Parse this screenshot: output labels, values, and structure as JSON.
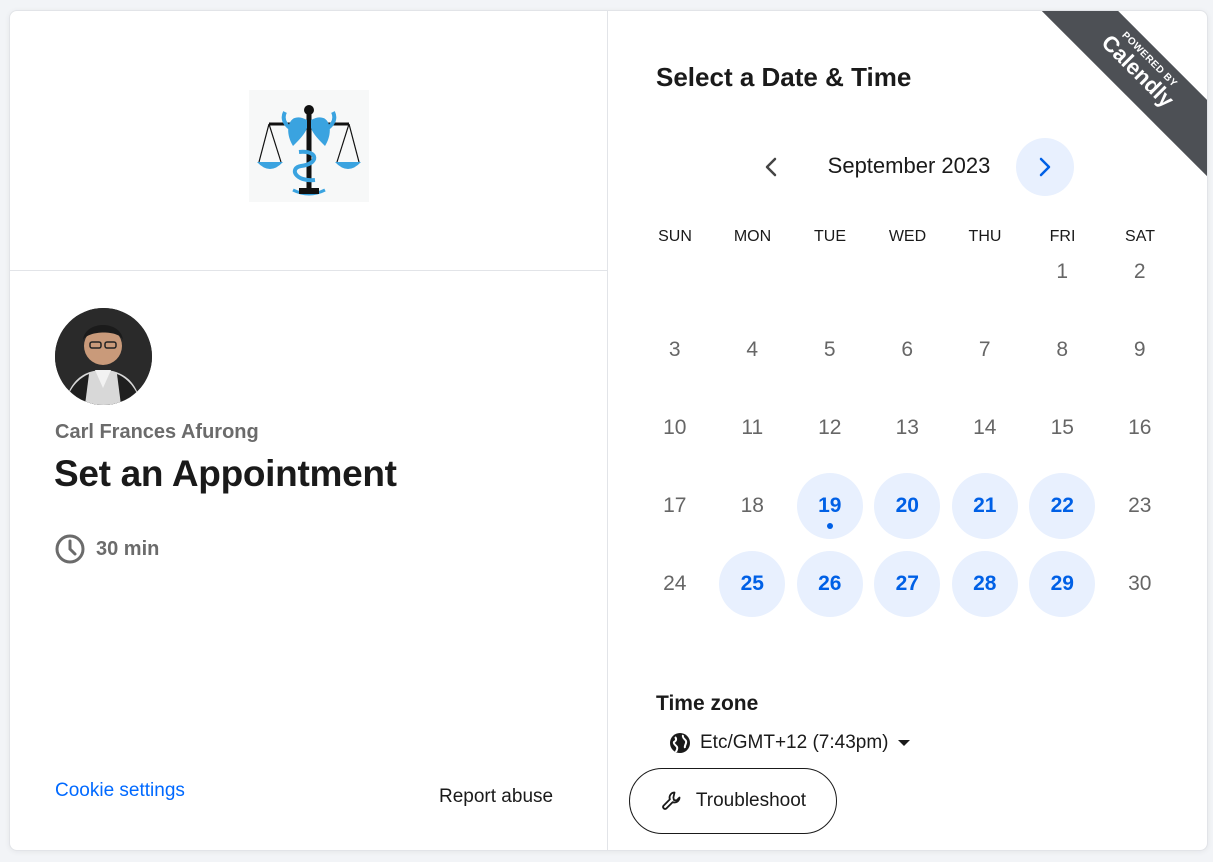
{
  "profile": {
    "host_name": "Carl Frances Afurong",
    "event_title": "Set an Appointment",
    "duration": "30 min"
  },
  "footer": {
    "cookie_settings": "Cookie settings",
    "report_abuse": "Report abuse"
  },
  "scheduler": {
    "heading": "Select a Date & Time",
    "month": "September 2023",
    "weekdays": [
      "SUN",
      "MON",
      "TUE",
      "WED",
      "THU",
      "FRI",
      "SAT"
    ],
    "days": [
      {
        "label": "1",
        "available": false
      },
      {
        "label": "2",
        "available": false
      },
      {
        "label": "3",
        "available": false
      },
      {
        "label": "4",
        "available": false
      },
      {
        "label": "5",
        "available": false
      },
      {
        "label": "6",
        "available": false
      },
      {
        "label": "7",
        "available": false
      },
      {
        "label": "8",
        "available": false
      },
      {
        "label": "9",
        "available": false
      },
      {
        "label": "10",
        "available": false
      },
      {
        "label": "11",
        "available": false
      },
      {
        "label": "12",
        "available": false
      },
      {
        "label": "13",
        "available": false
      },
      {
        "label": "14",
        "available": false
      },
      {
        "label": "15",
        "available": false
      },
      {
        "label": "16",
        "available": false
      },
      {
        "label": "17",
        "available": false
      },
      {
        "label": "18",
        "available": false
      },
      {
        "label": "19",
        "available": true,
        "today": true
      },
      {
        "label": "20",
        "available": true
      },
      {
        "label": "21",
        "available": true
      },
      {
        "label": "22",
        "available": true
      },
      {
        "label": "23",
        "available": false
      },
      {
        "label": "24",
        "available": false
      },
      {
        "label": "25",
        "available": true
      },
      {
        "label": "26",
        "available": true
      },
      {
        "label": "27",
        "available": true
      },
      {
        "label": "28",
        "available": true
      },
      {
        "label": "29",
        "available": true
      },
      {
        "label": "30",
        "available": false
      }
    ],
    "timezone_label": "Time zone",
    "timezone_value": "Etc/GMT+12 (7:43pm)"
  },
  "branding": {
    "powered_by": "POWERED BY",
    "brand": "Calendly"
  },
  "troubleshoot_label": "Troubleshoot",
  "colors": {
    "accent": "#0060e6",
    "available_bg": "#e8f0fe",
    "link": "#0069ff",
    "ribbon": "#4d5055"
  },
  "icons": {
    "prev": "chevron-left-icon",
    "next": "chevron-right-icon",
    "duration": "clock-icon",
    "timezone": "globe-icon",
    "troubleshoot": "wrench-icon"
  }
}
